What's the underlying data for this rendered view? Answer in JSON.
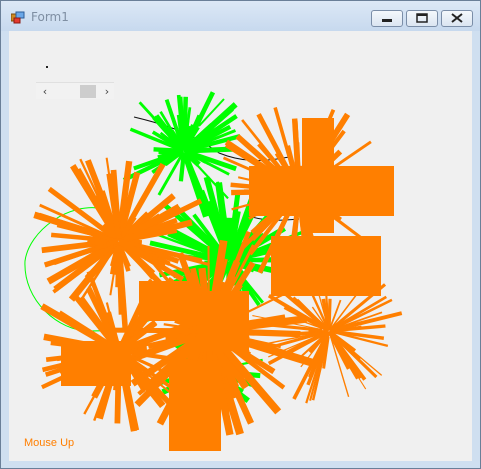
{
  "window": {
    "title": "Form1"
  },
  "caption_buttons": {
    "minimize": "minimize-icon",
    "maximize": "maximize-icon",
    "close": "close-icon"
  },
  "scrollbar": {
    "left_arrow": "‹",
    "right_arrow": "›",
    "position": 0.5
  },
  "status": {
    "text": "Mouse Up"
  },
  "colors": {
    "orange": "#ff7f00",
    "green": "#00ff00",
    "background": "#f0f0f0"
  }
}
